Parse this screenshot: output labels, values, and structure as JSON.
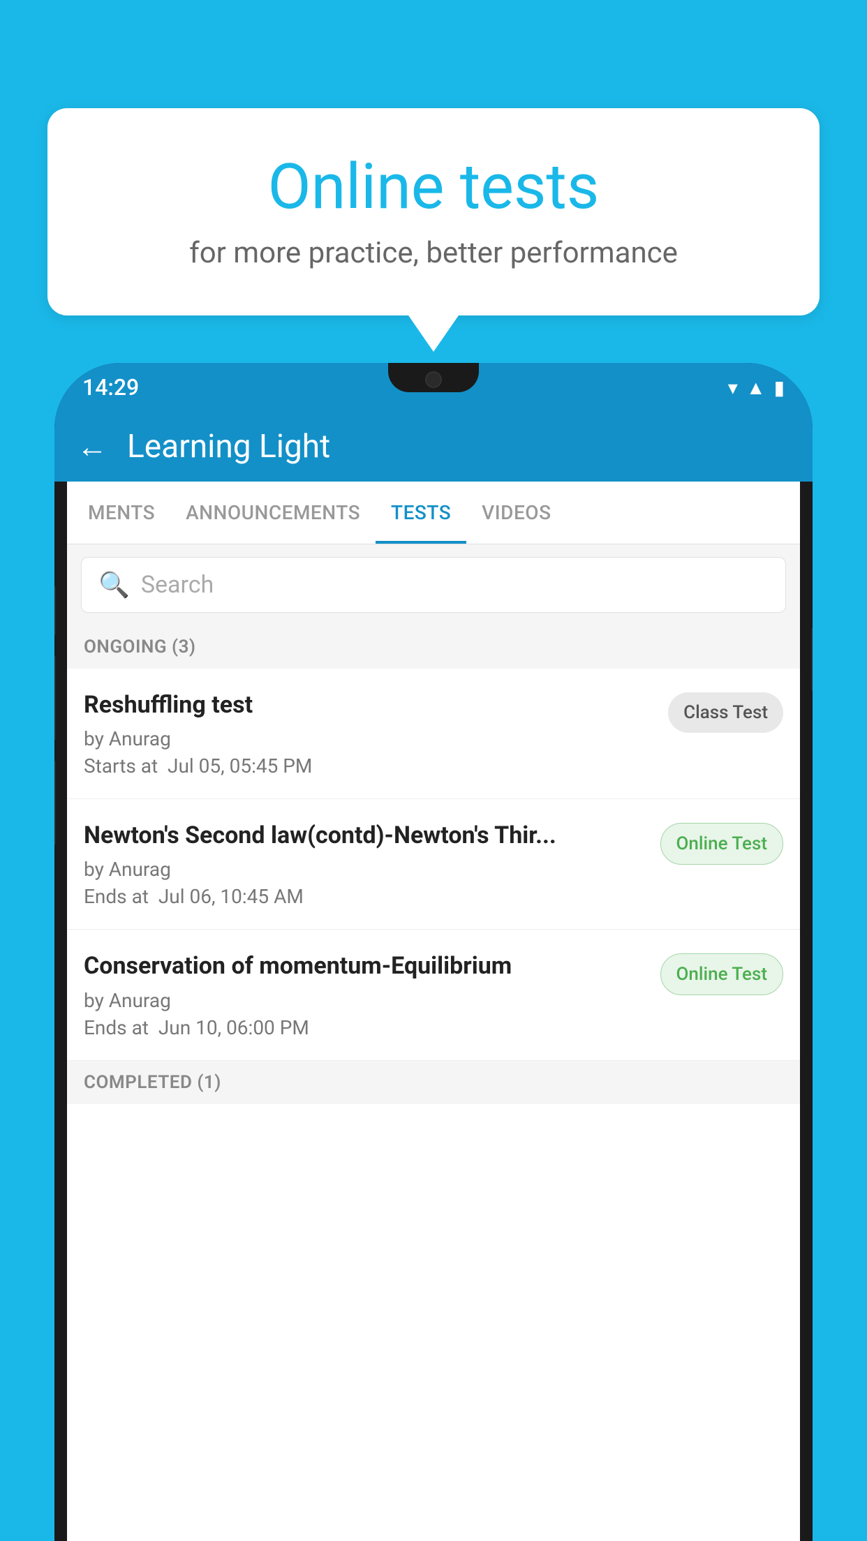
{
  "background_color": "#1ab8e8",
  "speech_bubble": {
    "title": "Online tests",
    "subtitle": "for more practice, better performance"
  },
  "phone": {
    "status_bar": {
      "time": "14:29",
      "icons": [
        "wifi",
        "signal",
        "battery"
      ]
    },
    "app_header": {
      "title": "Learning Light",
      "back_label": "←"
    },
    "tabs": [
      {
        "label": "MENTS",
        "active": false
      },
      {
        "label": "ANNOUNCEMENTS",
        "active": false
      },
      {
        "label": "TESTS",
        "active": true
      },
      {
        "label": "VIDEOS",
        "active": false
      }
    ],
    "search": {
      "placeholder": "Search"
    },
    "ongoing_section": {
      "label": "ONGOING (3)",
      "tests": [
        {
          "name": "Reshuffling test",
          "author": "by Anurag",
          "date": "Starts at  Jul 05, 05:45 PM",
          "badge": "Class Test",
          "badge_type": "class"
        },
        {
          "name": "Newton's Second law(contd)-Newton's Thir...",
          "author": "by Anurag",
          "date": "Ends at  Jul 06, 10:45 AM",
          "badge": "Online Test",
          "badge_type": "online"
        },
        {
          "name": "Conservation of momentum-Equilibrium",
          "author": "by Anurag",
          "date": "Ends at  Jun 10, 06:00 PM",
          "badge": "Online Test",
          "badge_type": "online"
        }
      ]
    },
    "completed_section": {
      "label": "COMPLETED (1)"
    }
  }
}
